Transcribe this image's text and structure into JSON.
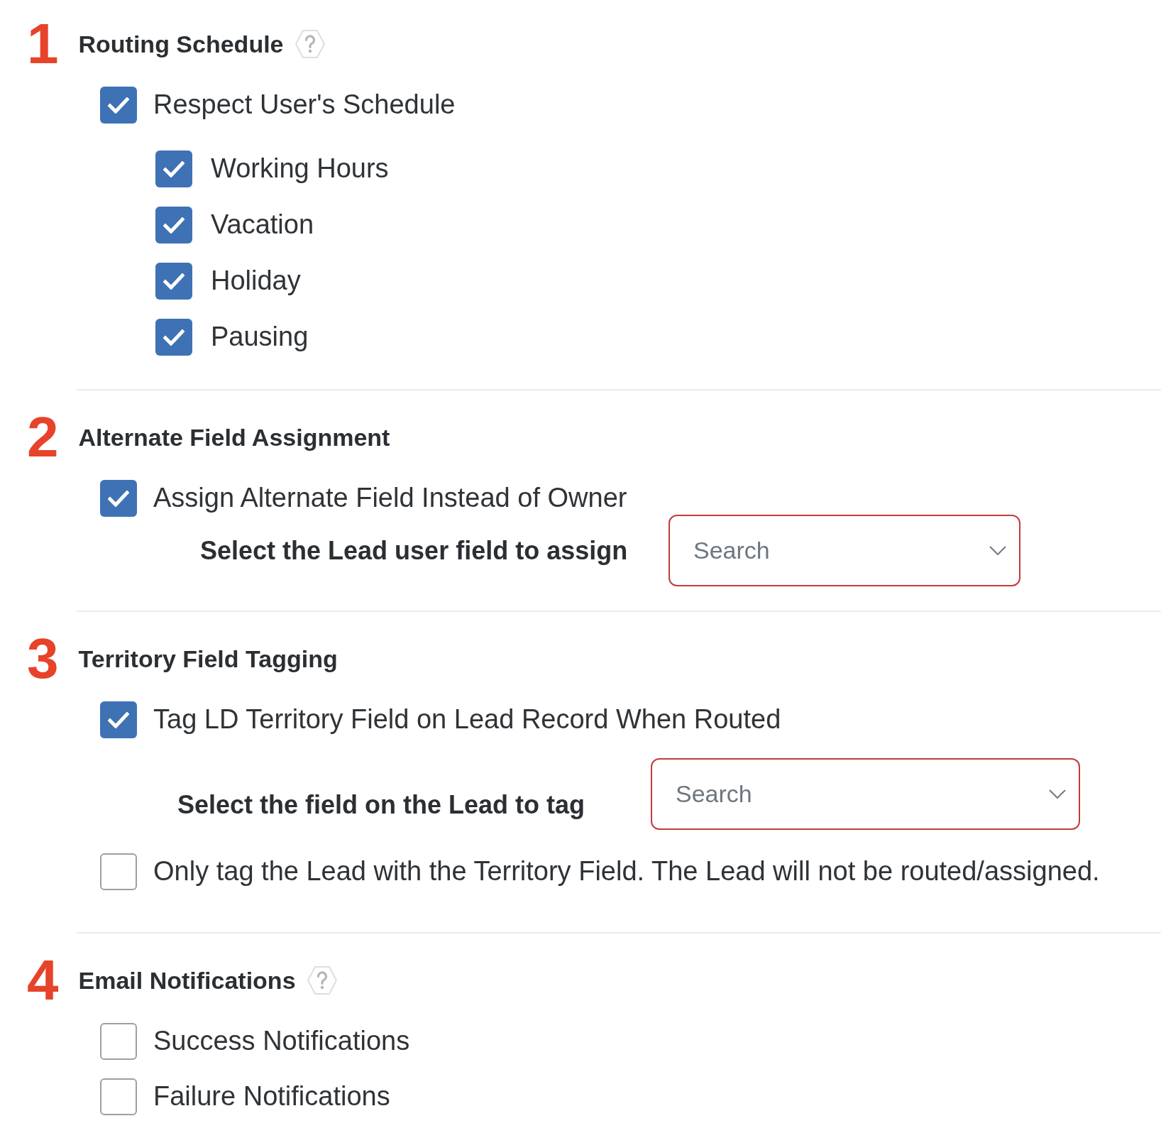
{
  "sections": [
    {
      "number": "1",
      "title": "Routing Schedule",
      "help": true,
      "items": [
        {
          "kind": "checkbox",
          "label": "Respect User's Schedule",
          "checked": true,
          "children": [
            {
              "label": "Working Hours",
              "checked": true
            },
            {
              "label": "Vacation",
              "checked": true
            },
            {
              "label": "Holiday",
              "checked": true
            },
            {
              "label": "Pausing",
              "checked": true
            }
          ]
        }
      ]
    },
    {
      "number": "2",
      "title": "Alternate Field Assignment",
      "help": false,
      "items": [
        {
          "kind": "checkbox",
          "label": "Assign Alternate Field Instead of Owner",
          "checked": true
        },
        {
          "kind": "select",
          "label": "Select the Lead user field to assign",
          "placeholder": "Search"
        }
      ]
    },
    {
      "number": "3",
      "title": "Territory Field Tagging",
      "help": false,
      "items": [
        {
          "kind": "checkbox",
          "label": "Tag LD Territory Field on Lead Record When Routed",
          "checked": true
        },
        {
          "kind": "select",
          "label": "Select the field on the Lead to tag",
          "placeholder": "Search"
        },
        {
          "kind": "checkbox",
          "label": "Only tag the Lead with the Territory Field. The Lead will not be routed/assigned.",
          "checked": false
        }
      ]
    },
    {
      "number": "4",
      "title": "Email Notifications",
      "help": true,
      "items": [
        {
          "kind": "checkbox",
          "label": "Success Notifications",
          "checked": false
        },
        {
          "kind": "checkbox",
          "label": "Failure Notifications",
          "checked": false
        }
      ]
    }
  ]
}
